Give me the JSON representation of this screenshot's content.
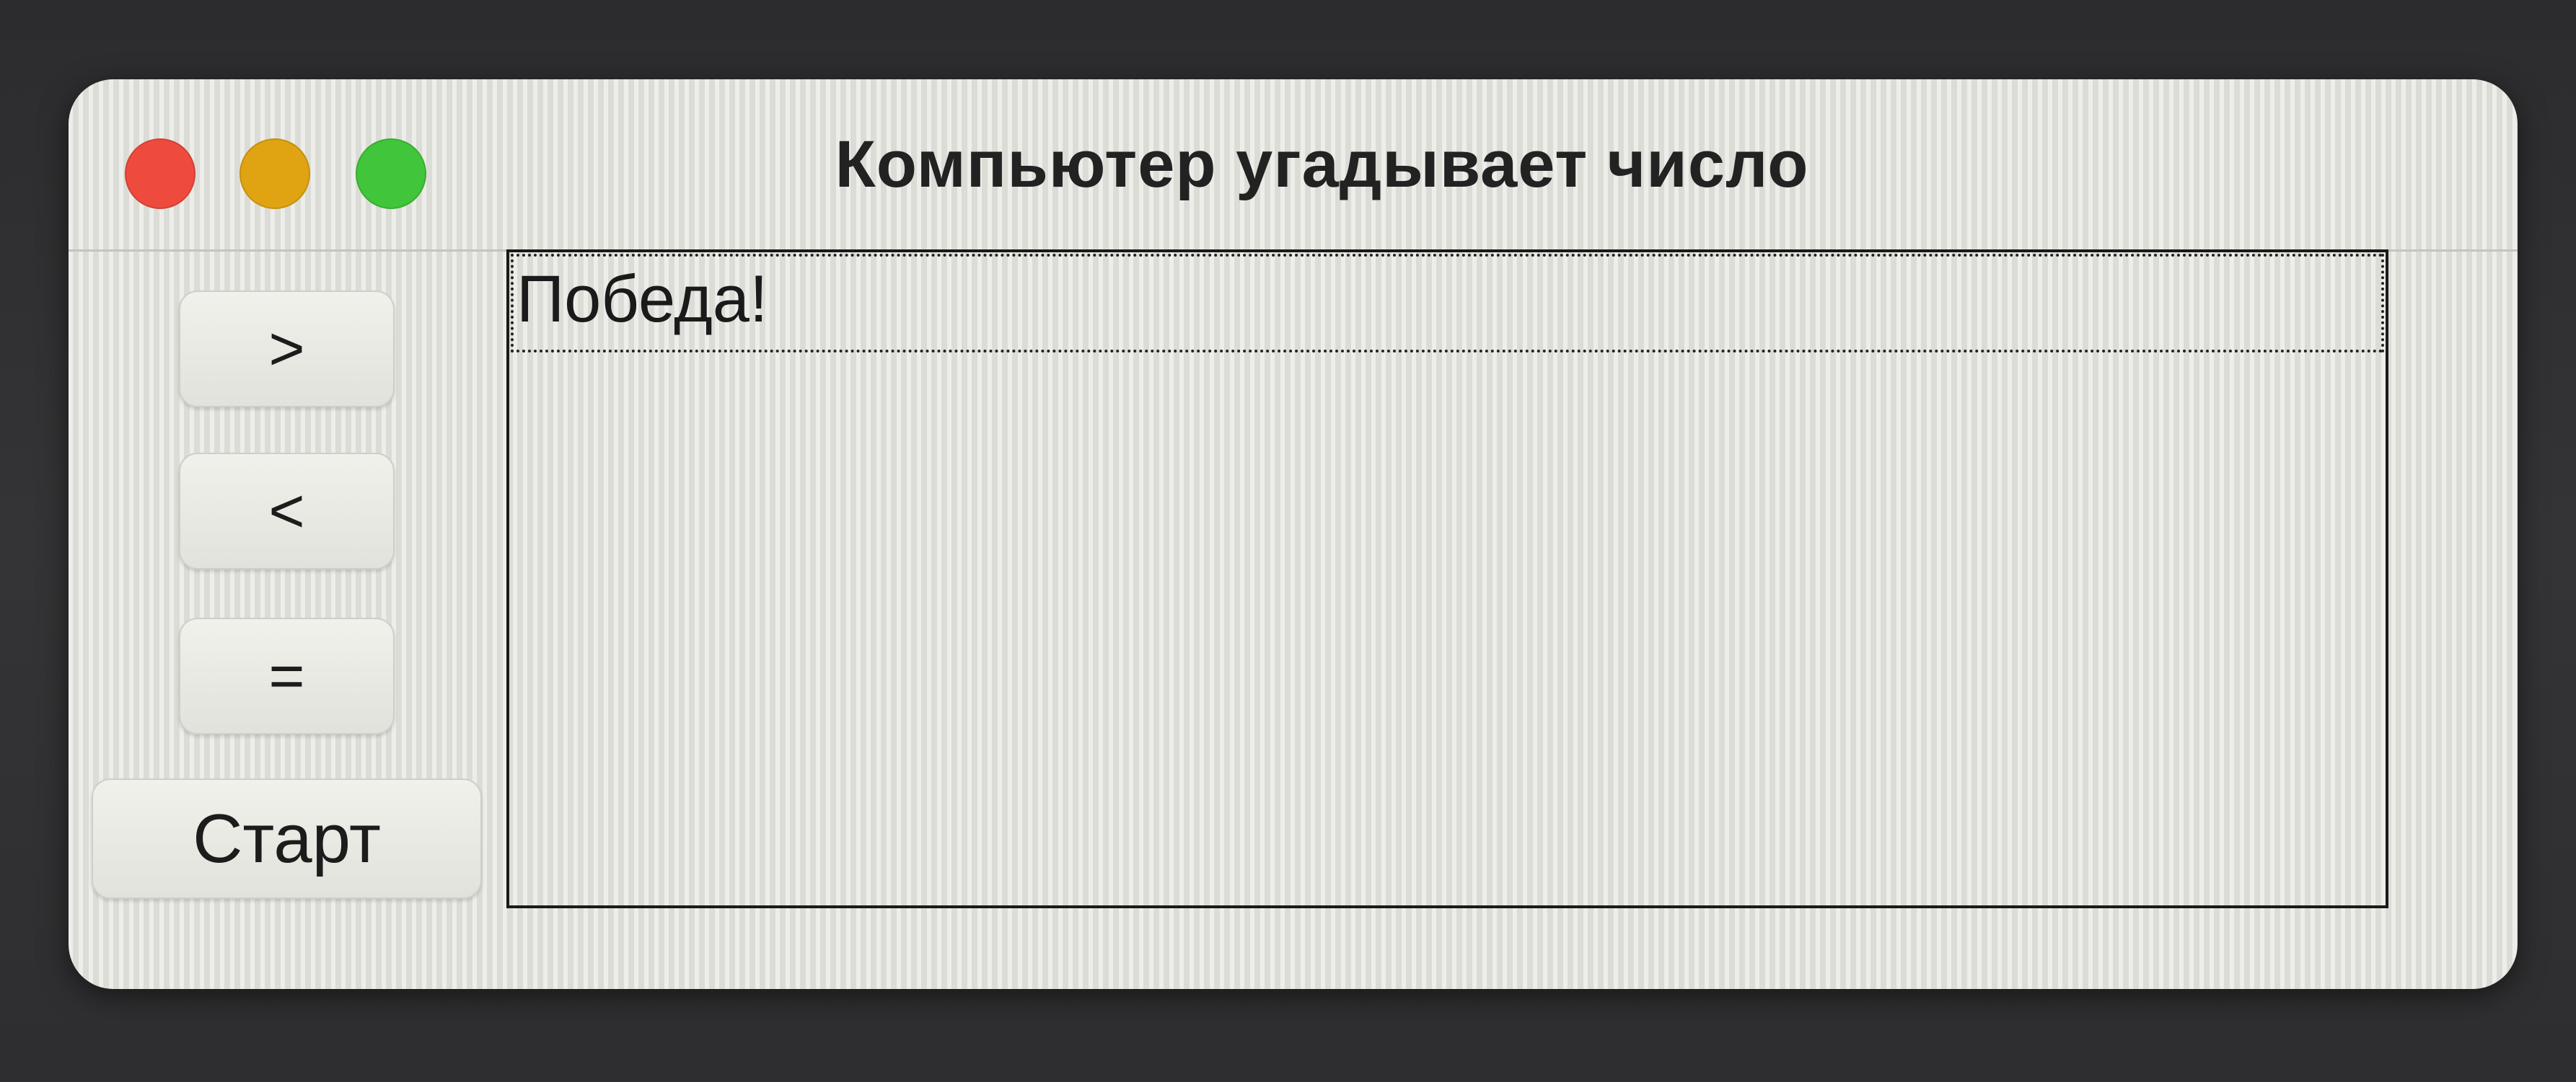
{
  "window": {
    "title": "Компьютер угадывает число",
    "traffic_lights": {
      "close_color": "#ee4b3e",
      "minimize_color": "#e0a412",
      "zoom_color": "#41c53a"
    }
  },
  "controls": {
    "greater_label": ">",
    "less_label": "<",
    "equal_label": "=",
    "start_label": "Старт"
  },
  "log": {
    "items": [
      "Победа!"
    ]
  }
}
